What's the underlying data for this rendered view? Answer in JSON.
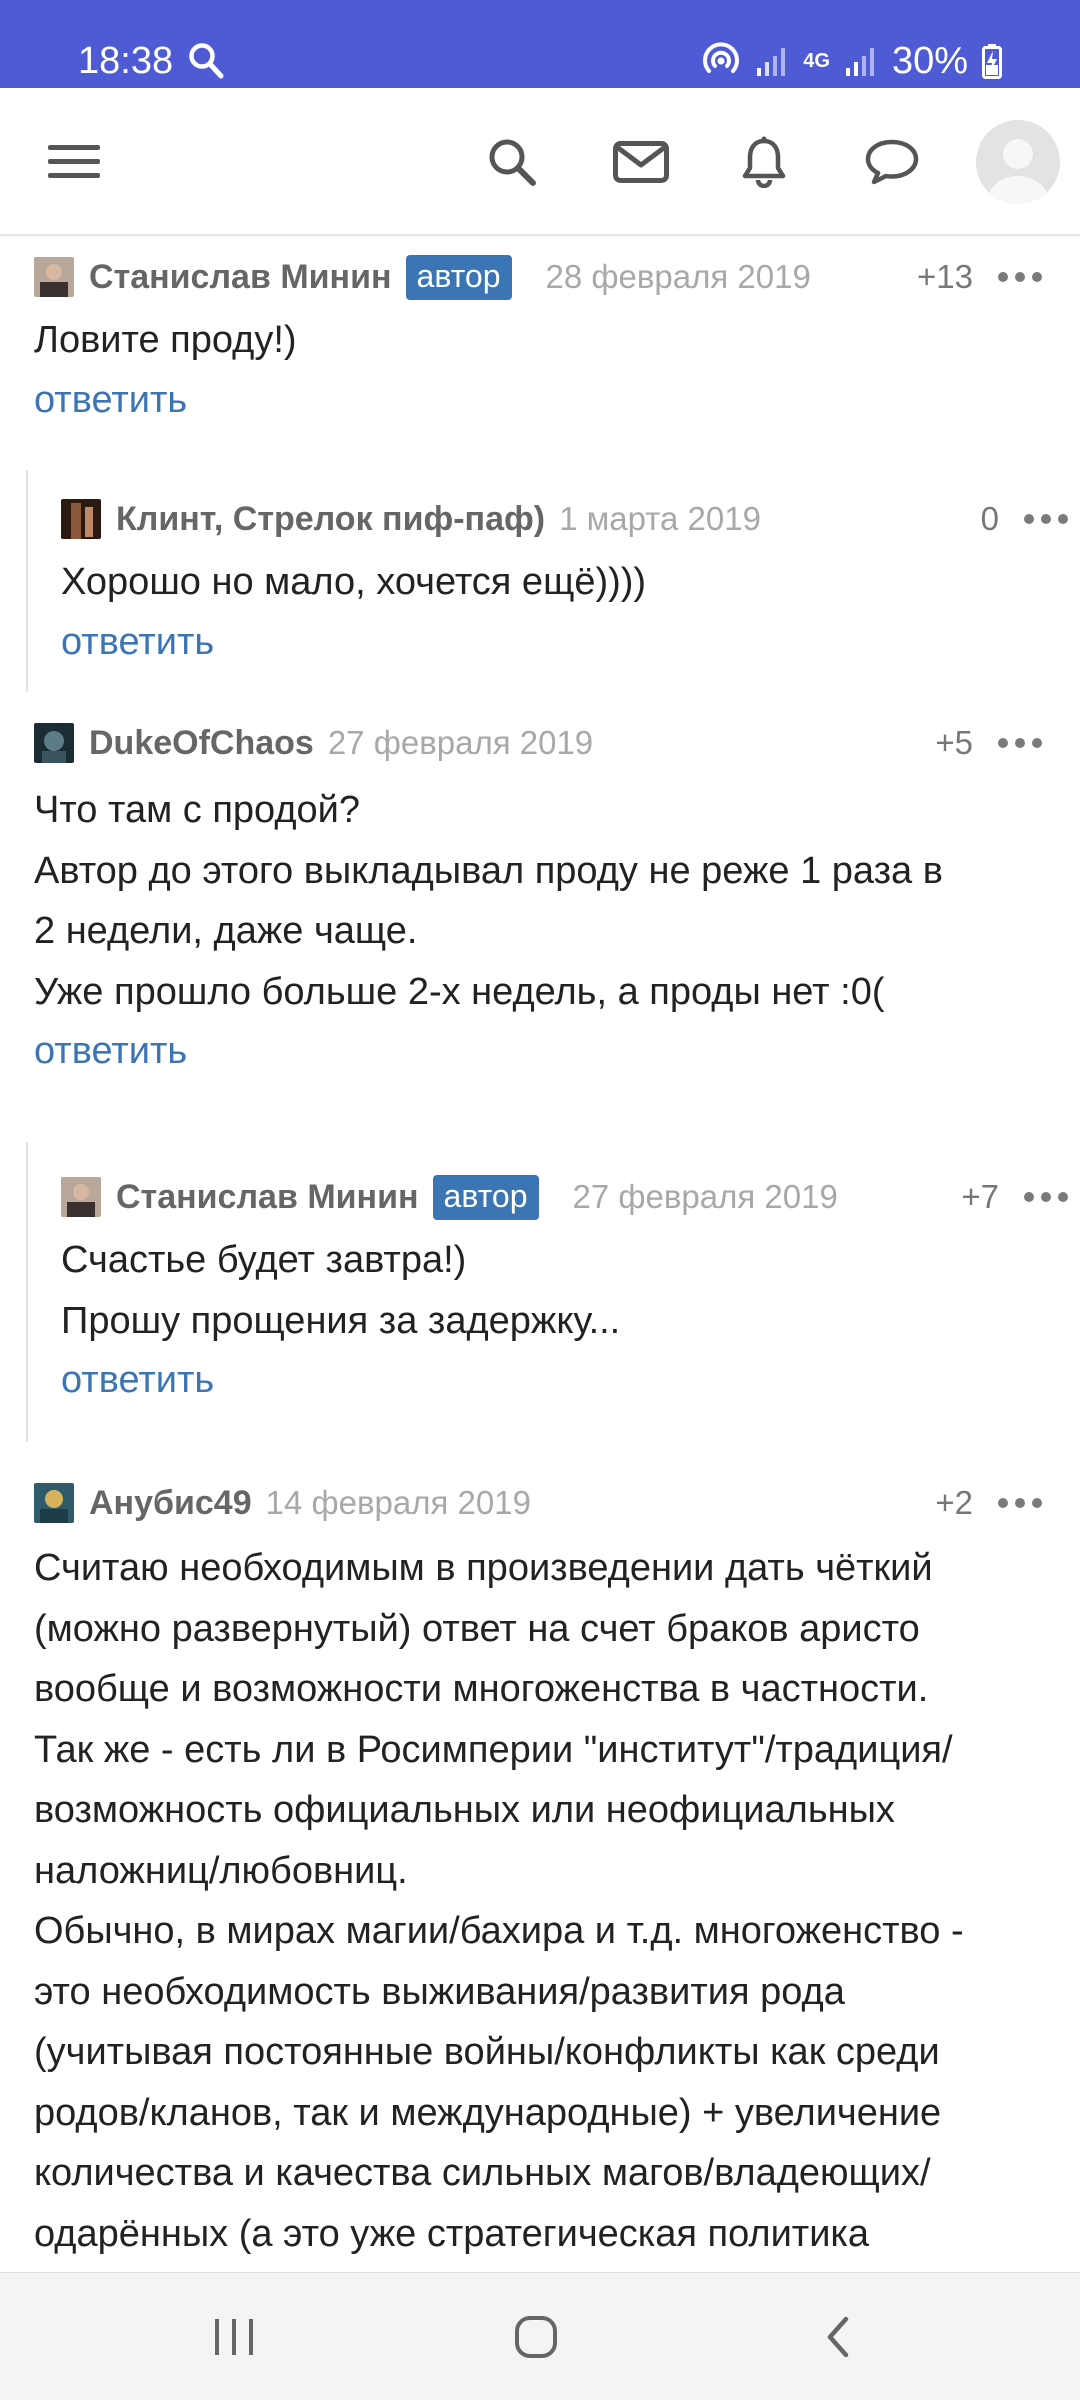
{
  "status_bar": {
    "time": "18:38",
    "network": "4G",
    "battery": "30%"
  },
  "header": {
    "icons": [
      "menu-icon",
      "search-icon",
      "mail-icon",
      "bell-icon",
      "chat-icon",
      "user-avatar"
    ]
  },
  "comments": [
    {
      "author": "Станислав Минин",
      "badge": "автор",
      "date": "28 февраля 2019",
      "score": "+13",
      "lines": [
        "Ловите проду!)"
      ],
      "reply_label": "ответить"
    },
    {
      "author": "Клинт, Стрелок пиф-паф)",
      "date": "1 марта 2019",
      "score": "0",
      "lines": [
        "Хорошо но мало, хочется ещё))))"
      ],
      "reply_label": "ответить"
    },
    {
      "author": "DukeOfChaos",
      "date": "27 февраля 2019",
      "score": "+5",
      "lines": [
        "Что там с продой?",
        "Автор до этого выкладывал проду не реже 1 раза в",
        "2 недели, даже чаще.",
        "Уже прошло больше 2-х недель, а проды нет :0("
      ],
      "reply_label": "ответить"
    },
    {
      "author": "Станислав Минин",
      "badge": "автор",
      "date": "27 февраля 2019",
      "score": "+7",
      "lines": [
        "Счастье будет завтра!)",
        "Прошу прощения за задержку..."
      ],
      "reply_label": "ответить"
    },
    {
      "author": "Анубис49",
      "date": "14 февраля 2019",
      "score": "+2",
      "lines": [
        "Считаю необходимым в произведении дать чёткий",
        "(можно развернутый)  ответ на счет браков аристо",
        "вообще и возможности многоженства в частности.",
        "Так же - есть ли в Росимперии  \"институт\"/традиция/",
        "возможность официальных или неофициальных",
        "наложниц/любовниц.",
        "Обычно, в мирах магии/бахира и т.д. многоженство -",
        "это необходимость выживания/развития рода",
        "(учитывая постоянные войны/конфликты как среди",
        "родов/кланов, так и международные) + увеличение",
        "количества и качества сильных магов/владеющих/",
        "одарённых (а это уже стратегическая политика"
      ]
    }
  ],
  "colors": {
    "status_bar": "#4f5bd5",
    "link": "#3c75b3",
    "badge_bg": "#3c75b3"
  }
}
